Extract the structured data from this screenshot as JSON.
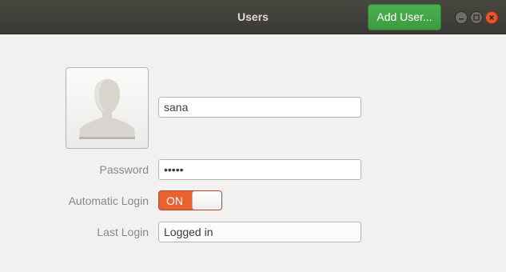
{
  "window": {
    "title": "Users",
    "add_user_label": "Add User..."
  },
  "icons": {
    "avatar": "person-silhouette-icon",
    "minimize": "minimize-icon",
    "maximize": "maximize-icon",
    "close": "close-icon"
  },
  "user": {
    "name": "sana",
    "password_mask": "•••••",
    "password_label": "Password",
    "automatic_login_label": "Automatic Login",
    "automatic_login_state": "ON",
    "last_login_label": "Last Login",
    "last_login_value": "Logged in"
  },
  "colors": {
    "accent_green": "#3ea044",
    "switch_on": "#e9622f",
    "close_button": "#e9552c",
    "titlebar": "#3f3e39"
  }
}
